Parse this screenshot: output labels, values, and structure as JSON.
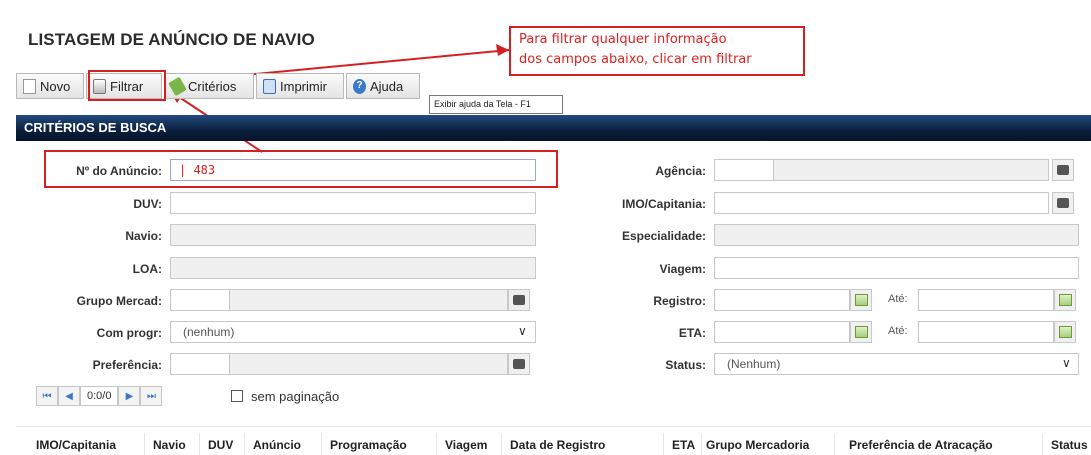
{
  "page": {
    "title": "LISTAGEM DE ANÚNCIO DE NAVIO"
  },
  "annotation": {
    "line1": "Para filtrar qualquer informação",
    "line2": "dos campos abaixo, clicar em filtrar"
  },
  "toolbar": {
    "novo": "Novo",
    "filtrar": "Filtrar",
    "criterios": "Critérios",
    "imprimir": "Imprimir",
    "ajuda": "Ajuda"
  },
  "tooltip": "Exibir ajuda da Tela - F1",
  "section": {
    "title": "CRITÉRIOS DE BUSCA"
  },
  "form": {
    "left": {
      "num_anuncio": {
        "label": "Nº do Anúncio:",
        "value": "| 483"
      },
      "duv": {
        "label": "DUV:",
        "value": ""
      },
      "navio": {
        "label": "Navio:",
        "value": ""
      },
      "loa": {
        "label": "LOA:",
        "value": ""
      },
      "grupo_mercad": {
        "label": "Grupo Mercad:",
        "value": ""
      },
      "com_progr": {
        "label": "Com progr:",
        "value": "(nenhum)"
      },
      "preferencia": {
        "label": "Preferência:",
        "value": ""
      }
    },
    "right": {
      "agencia": {
        "label": "Agência:",
        "value": ""
      },
      "imo_capitania": {
        "label": "IMO/Capitania:",
        "value": ""
      },
      "especialidade": {
        "label": "Especialidade:",
        "value": ""
      },
      "viagem": {
        "label": "Viagem:",
        "value": ""
      },
      "registro": {
        "label": "Registro:",
        "ate": "Até:"
      },
      "eta": {
        "label": "ETA:",
        "ate": "Até:"
      },
      "status": {
        "label": "Status:",
        "value": "(Nenhum)"
      }
    }
  },
  "pager": {
    "count": "0:0/0",
    "sem_paginacao": "sem paginação"
  },
  "table": {
    "columns": [
      "IMO/Capitania",
      "Navio",
      "DUV",
      "Anúncio",
      "Programação",
      "Viagem",
      "Data de Registro",
      "ETA",
      "Grupo Mercadoria",
      "Preferência de Atracação",
      "Status"
    ]
  },
  "colors": {
    "header_bg": "#0a1f3d",
    "highlight": "#d42020"
  }
}
